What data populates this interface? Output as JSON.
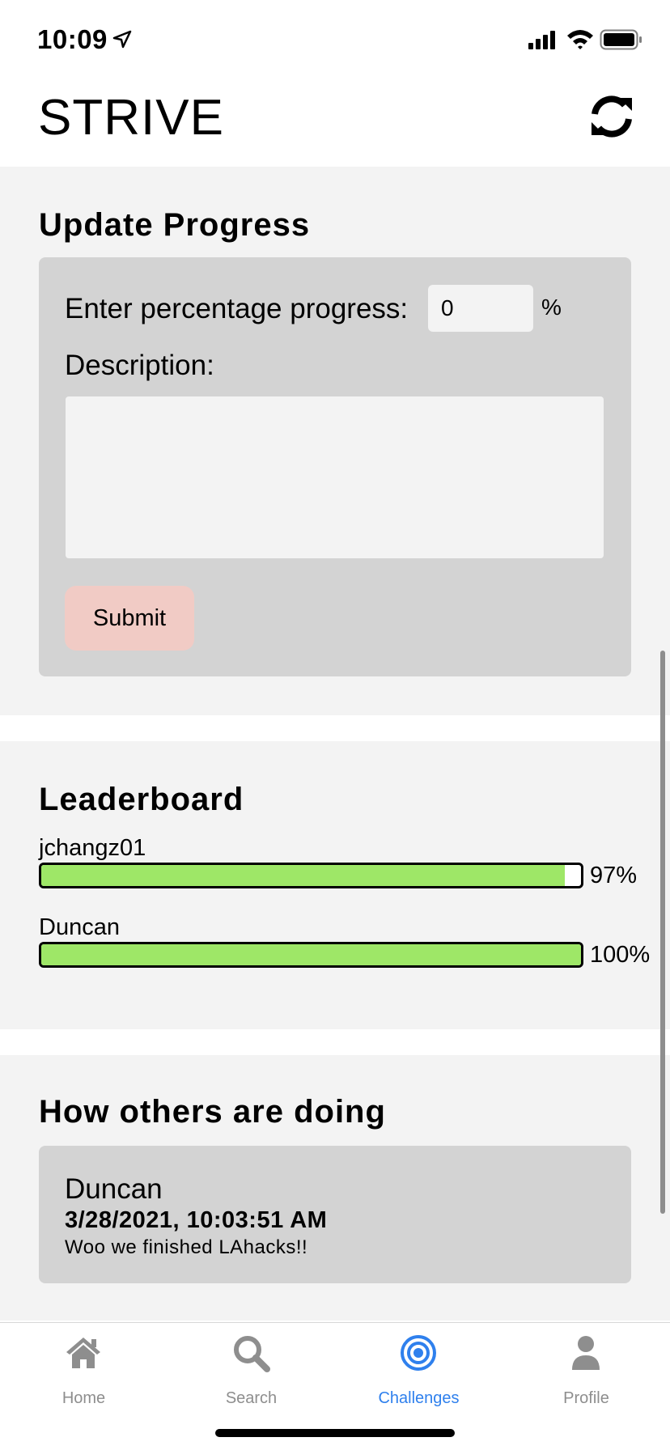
{
  "status_bar": {
    "time": "10:09"
  },
  "header": {
    "title": "STRIVE"
  },
  "update_progress": {
    "title": "Update Progress",
    "percentage_label": "Enter percentage progress:",
    "percentage_value": "0",
    "percent_sign": "%",
    "description_label": "Description:",
    "description_value": "",
    "submit_label": "Submit"
  },
  "leaderboard": {
    "title": "Leaderboard",
    "entries": [
      {
        "name": "jchangz01",
        "progress": 97,
        "progress_label": "97%"
      },
      {
        "name": "Duncan",
        "progress": 100,
        "progress_label": "100%"
      }
    ],
    "bar_color": "#9ee767"
  },
  "others": {
    "title": "How others are doing",
    "posts": [
      {
        "user": "Duncan",
        "timestamp": "3/28/2021, 10:03:51 AM",
        "description": "Woo we finished LAhacks!!"
      }
    ]
  },
  "tab_bar": {
    "tabs": [
      {
        "label": "Home",
        "icon": "house-icon",
        "active": false
      },
      {
        "label": "Search",
        "icon": "magnifier-icon",
        "active": false
      },
      {
        "label": "Challenges",
        "icon": "target-icon",
        "active": true
      },
      {
        "label": "Profile",
        "icon": "person-icon",
        "active": false
      }
    ],
    "active_color": "#2f80ed",
    "inactive_color": "#8e8e8e"
  }
}
